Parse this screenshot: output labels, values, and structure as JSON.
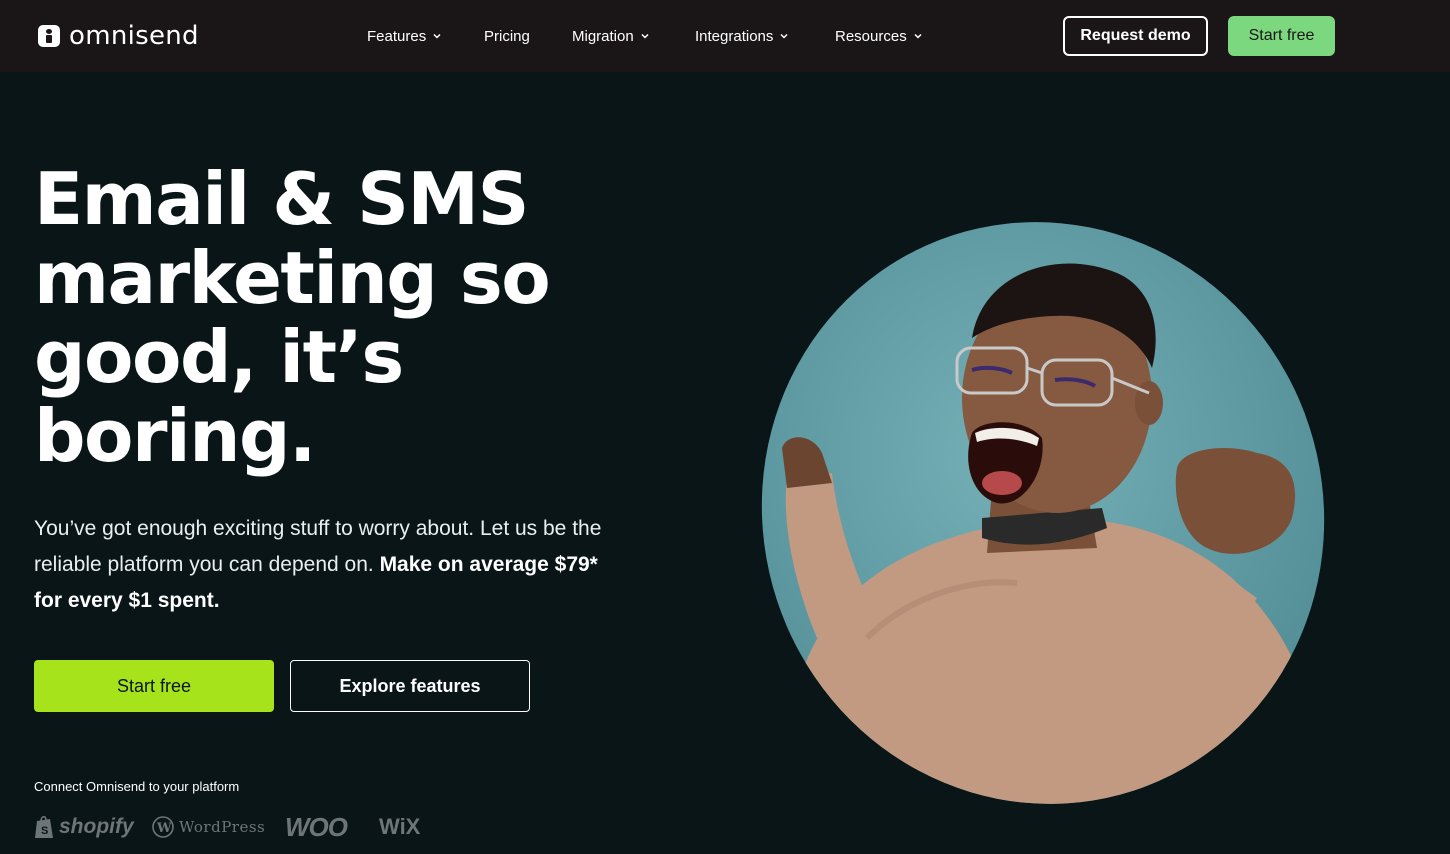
{
  "brand": {
    "name": "omnisend"
  },
  "nav": {
    "items": [
      {
        "label": "Features",
        "dropdown": true
      },
      {
        "label": "Pricing",
        "dropdown": false
      },
      {
        "label": "Migration",
        "dropdown": true
      },
      {
        "label": "Integrations",
        "dropdown": true
      },
      {
        "label": "Resources",
        "dropdown": true
      }
    ],
    "request_demo": "Request demo",
    "start_free": "Start free"
  },
  "hero": {
    "headline": [
      "Email & SMS",
      "marketing so",
      "good, it’s",
      "boring."
    ],
    "subtext_regular": "You’ve got enough exciting stuff to worry about. Let us be the reliable platform you can depend on.",
    "subtext_bold": "Make on average $79* for every $1 spent.",
    "cta_primary": "Start free",
    "cta_secondary": "Explore features",
    "connect_label": "Connect Omnisend to your platform",
    "platforms": [
      {
        "name": "shopify",
        "icon": "shopify-bag-icon"
      },
      {
        "name": "WordPress",
        "icon": "wordpress-icon"
      },
      {
        "name": "WOO",
        "icon": "woo-icon"
      },
      {
        "name": "WiX",
        "icon": "wix-icon"
      }
    ]
  },
  "colors": {
    "page_bg": "#0a1518",
    "nav_bg": "#1a1617",
    "nav_start_btn": "#7bd87e",
    "primary_cta": "#a6e31b",
    "photo_bg": "#5e9ba3",
    "shirt": "#c29a82"
  }
}
